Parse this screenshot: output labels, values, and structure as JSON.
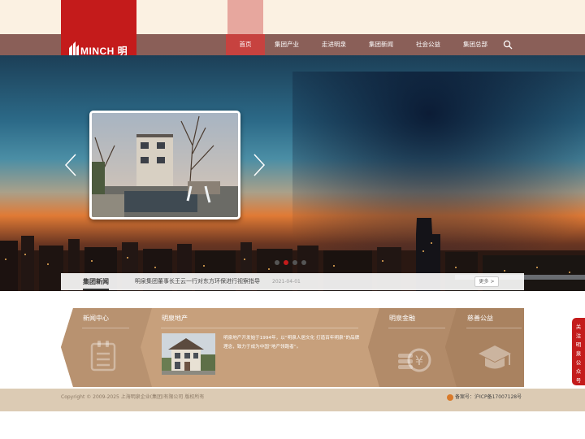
{
  "brand": {
    "logo_text": "MINCH 明泉"
  },
  "nav": {
    "items": [
      {
        "label": "首页",
        "active": true
      },
      {
        "label": "集团产业"
      },
      {
        "label": "走进明泉"
      },
      {
        "label": "集团新闻"
      },
      {
        "label": "社会公益"
      },
      {
        "label": "集团总部"
      }
    ],
    "search_icon": "search-icon"
  },
  "hero": {
    "prev_icon": "chevron-left-icon",
    "next_icon": "chevron-right-icon",
    "slides_count": 4,
    "active_slide": 2
  },
  "news": {
    "section_title": "集团新闻",
    "headline": "明泉集团董事长王云一行对东方环保进行视察指导",
    "date": "2021-04-01",
    "more_label": "更多 >"
  },
  "panels": {
    "news_center": {
      "title": "新闻中心"
    },
    "real_estate": {
      "title": "明泉地产",
      "description": "明泉地产开发始于1994年，以“明泉人居文化 打造百年明泉”的品牌理念，致力于成为中国“地产领跑者”。"
    },
    "finance": {
      "title": "明泉金融"
    },
    "charity": {
      "title": "慈善公益"
    }
  },
  "footer": {
    "copyright": "Copyright © 2009-2025 上海明泉企业(集团)有限公司 版权所有",
    "icp": "备案号：沪ICP备17007128号"
  },
  "follow_tab": {
    "chars": [
      "关",
      "注",
      "明",
      "泉",
      "公",
      "众",
      "号"
    ]
  },
  "colors": {
    "brand_red": "#c41b1b",
    "nav_brown": "#8a5f58",
    "nav_active": "#c7423f",
    "panel_tan": "#b08a6a",
    "footer_tan": "#dccbb4"
  }
}
